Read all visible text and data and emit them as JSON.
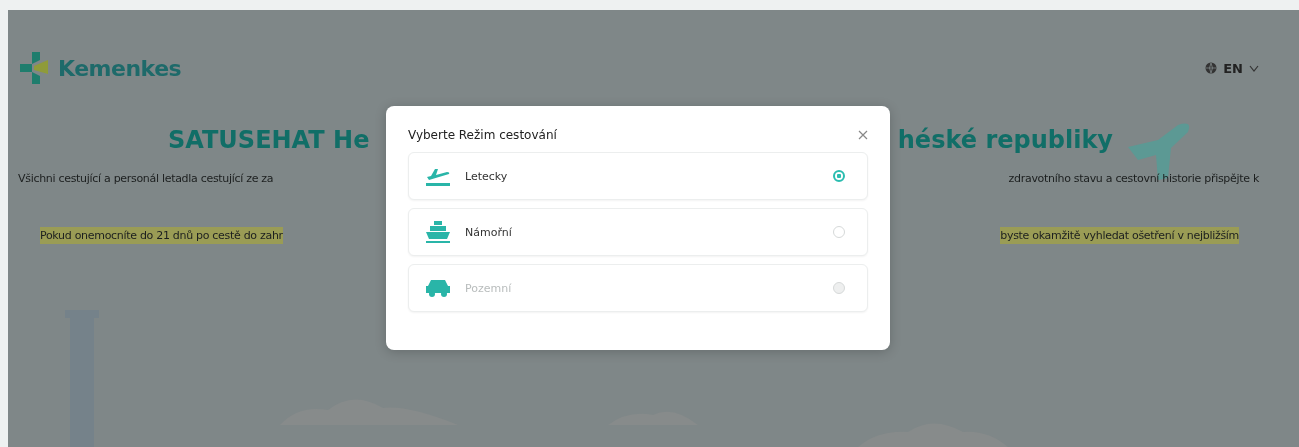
{
  "header": {
    "logo": "Kemenkes",
    "language": "EN"
  },
  "title": {
    "left": "SATUSEHAT He",
    "right": "héské republiky"
  },
  "intro": {
    "left": "Všichni cestující a personál letadla cestující ze za",
    "right": "zdravotního stavu a cestovní historie přispějte k"
  },
  "warning": {
    "left": "Pokud onemocníte do 21 dnů po cestě do zahr",
    "right": "byste okamžitě vyhledat ošetření v nejbližším"
  },
  "modal": {
    "title": "Vyberte Režim cestování",
    "options": [
      {
        "kind": "plane",
        "label": "Letecky",
        "selected": true,
        "disabled": false
      },
      {
        "kind": "ship",
        "label": "Námořní",
        "selected": false,
        "disabled": false
      },
      {
        "kind": "car",
        "label": "Pozemní",
        "selected": false,
        "disabled": true
      }
    ]
  }
}
